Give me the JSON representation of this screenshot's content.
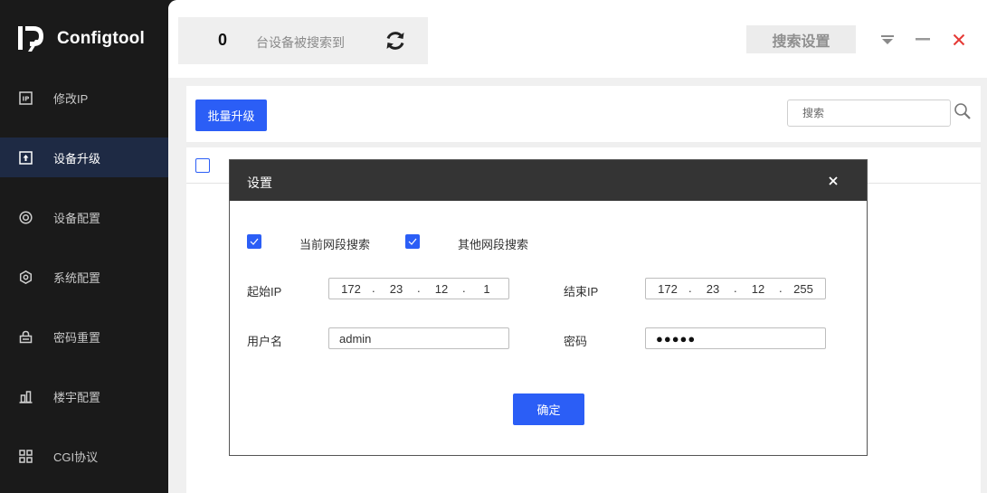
{
  "app": {
    "name": "Configtool"
  },
  "sidebar": {
    "items": [
      {
        "label": "修改IP",
        "icon": "ip-icon"
      },
      {
        "label": "设备升级",
        "icon": "upload-icon",
        "active": true
      },
      {
        "label": "设备配置",
        "icon": "target-icon"
      },
      {
        "label": "系统配置",
        "icon": "hexagon-gear-icon"
      },
      {
        "label": "密码重置",
        "icon": "lock-icon"
      },
      {
        "label": "楼宇配置",
        "icon": "building-icon"
      },
      {
        "label": "CGI协议",
        "icon": "grid-icon"
      }
    ]
  },
  "header": {
    "device_count": "0",
    "device_count_label": "台设备被搜索到",
    "search_settings_label": "搜索设置"
  },
  "toolbar": {
    "batch_upgrade_label": "批量升级",
    "search_placeholder": "搜索"
  },
  "modal": {
    "title": "设置",
    "current_segment_label": "当前网段搜索",
    "other_segment_label": "其他网段搜索",
    "current_segment_checked": true,
    "other_segment_checked": true,
    "start_ip_label": "起始IP",
    "end_ip_label": "结束IP",
    "start_ip": [
      "172",
      "23",
      "12",
      "1"
    ],
    "end_ip": [
      "172",
      "23",
      "12",
      "255"
    ],
    "username_label": "用户名",
    "username_value": "admin",
    "password_label": "密码",
    "password_mask": "●●●●●",
    "confirm_label": "确定"
  },
  "colors": {
    "accent": "#2b5ef6",
    "sidebar_bg": "#1a1a1a",
    "sidebar_active_bg": "#1e2a44",
    "modal_header_bg": "#343434",
    "close_red": "#e53935"
  }
}
